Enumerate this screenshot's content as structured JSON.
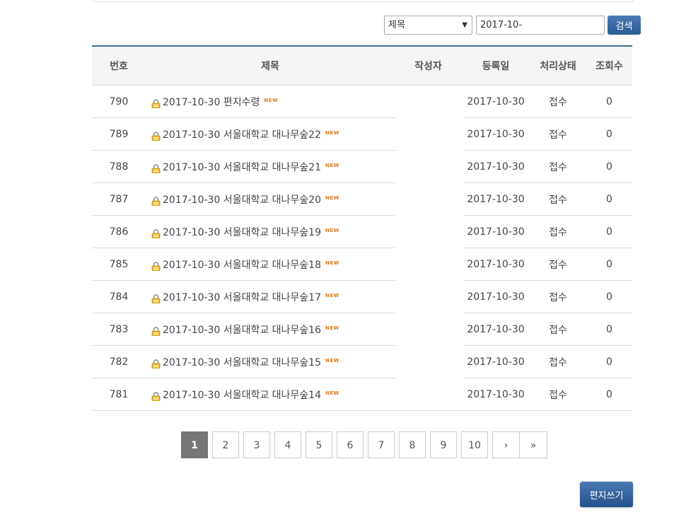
{
  "search": {
    "field_selected": "제목",
    "keyword_value": "2017-10-",
    "button_label": "검색"
  },
  "table": {
    "headers": {
      "no": "번호",
      "title": "제목",
      "writer": "작성자",
      "date": "등록일",
      "status": "처리상태",
      "views": "조회수"
    },
    "rows": [
      {
        "no": "790",
        "title": "2017-10-30 편지수령",
        "new": "NEW",
        "writer": "",
        "date": "2017-10-30",
        "status": "접수",
        "views": "0"
      },
      {
        "no": "789",
        "title": "2017-10-30 서울대학교 대나무숲22",
        "new": "NEW",
        "writer": "",
        "date": "2017-10-30",
        "status": "접수",
        "views": "0"
      },
      {
        "no": "788",
        "title": "2017-10-30 서울대학교 대나무숲21",
        "new": "NEW",
        "writer": "",
        "date": "2017-10-30",
        "status": "접수",
        "views": "0"
      },
      {
        "no": "787",
        "title": "2017-10-30 서울대학교 대나무숲20",
        "new": "NEW",
        "writer": "",
        "date": "2017-10-30",
        "status": "접수",
        "views": "0"
      },
      {
        "no": "786",
        "title": "2017-10-30 서울대학교 대나무숲19",
        "new": "NEW",
        "writer": "",
        "date": "2017-10-30",
        "status": "접수",
        "views": "0"
      },
      {
        "no": "785",
        "title": "2017-10-30 서울대학교 대나무숲18",
        "new": "NEW",
        "writer": "",
        "date": "2017-10-30",
        "status": "접수",
        "views": "0"
      },
      {
        "no": "784",
        "title": "2017-10-30 서울대학교 대나무숲17",
        "new": "NEW",
        "writer": "",
        "date": "2017-10-30",
        "status": "접수",
        "views": "0"
      },
      {
        "no": "783",
        "title": "2017-10-30 서울대학교 대나무숲16",
        "new": "NEW",
        "writer": "",
        "date": "2017-10-30",
        "status": "접수",
        "views": "0"
      },
      {
        "no": "782",
        "title": "2017-10-30 서울대학교 대나무숲15",
        "new": "NEW",
        "writer": "",
        "date": "2017-10-30",
        "status": "접수",
        "views": "0"
      },
      {
        "no": "781",
        "title": "2017-10-30 서울대학교 대나무숲14",
        "new": "NEW",
        "writer": "",
        "date": "2017-10-30",
        "status": "접수",
        "views": "0"
      }
    ],
    "row_icon": "lock-icon",
    "new_badge_color": "#e07a1e"
  },
  "pagination": {
    "pages": [
      "1",
      "2",
      "3",
      "4",
      "5",
      "6",
      "7",
      "8",
      "9",
      "10"
    ],
    "current": "1",
    "next_label": "›",
    "last_label": "»"
  },
  "write_button_label": "편지쓰기",
  "colors": {
    "accent": "#3a6b9e",
    "button": "#2c5a93",
    "active_page": "#777777"
  }
}
